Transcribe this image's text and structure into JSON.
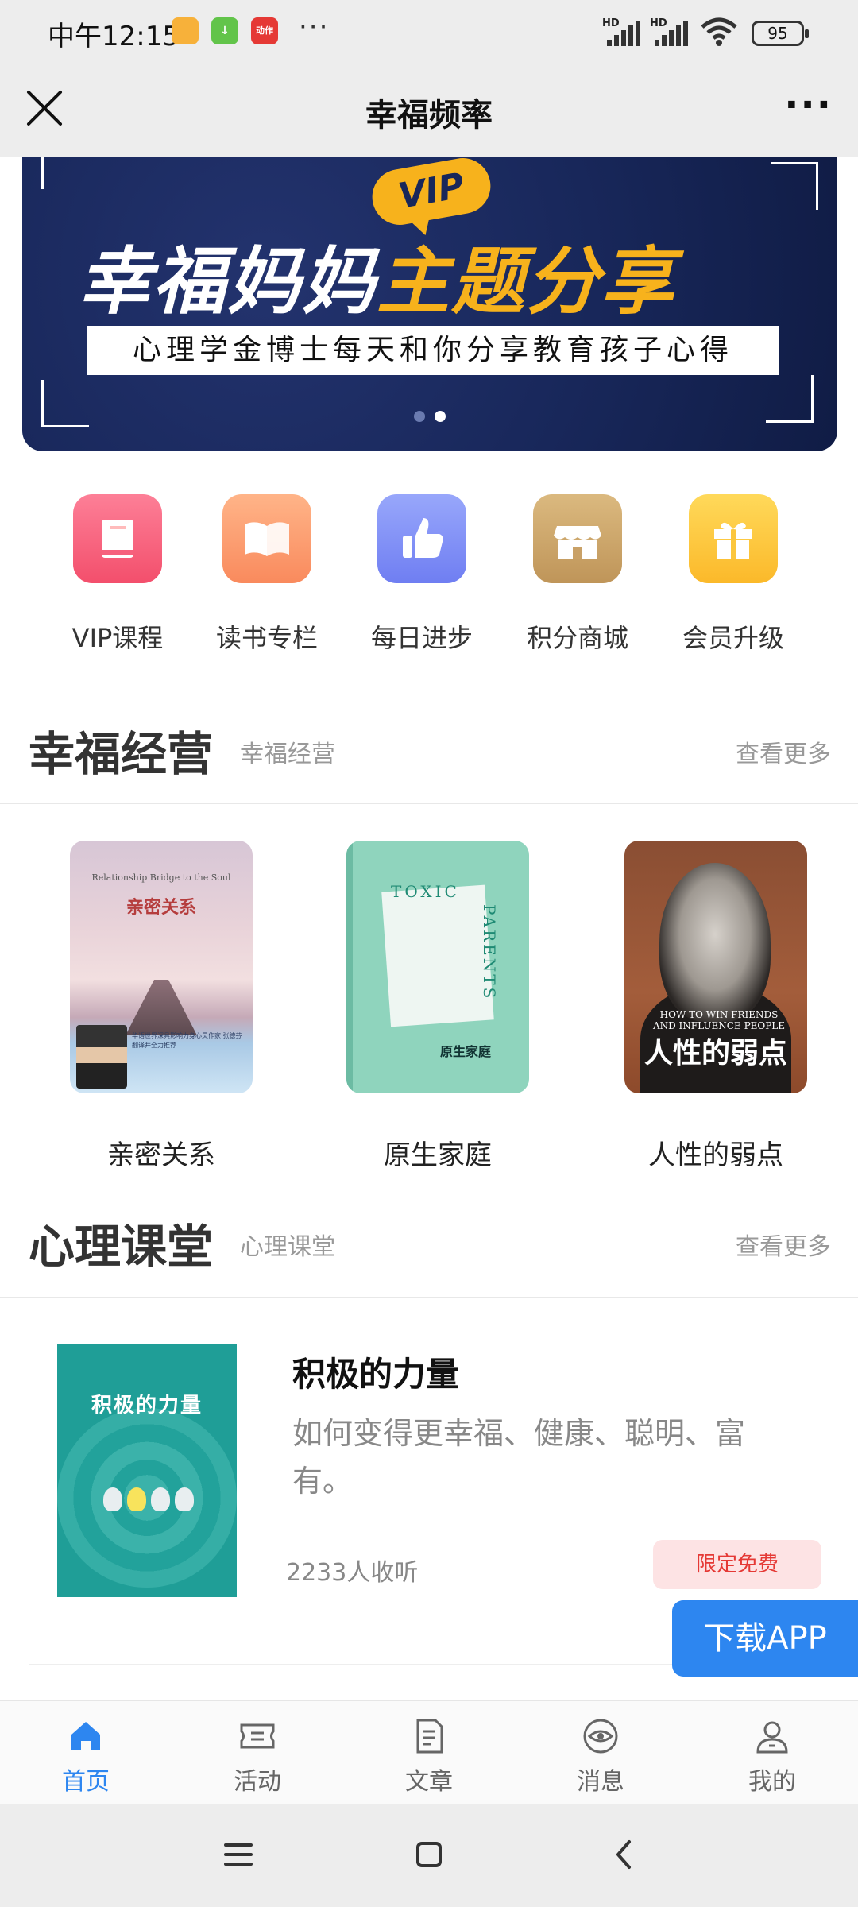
{
  "status_bar": {
    "time": "中午12:15",
    "apps": [
      "📙",
      "↓",
      "动作"
    ],
    "dots": "···",
    "signal1": "HD",
    "signal2": "HD",
    "battery": "95"
  },
  "nav": {
    "title": "幸福频率",
    "more": "···"
  },
  "banner": {
    "vip": "VIP",
    "title_white": "幸福妈妈",
    "title_yellow": "主题分享",
    "subtitle": "心理学金博士每天和你分享教育孩子心得",
    "slide_count": 2,
    "active_slide": 2
  },
  "quick_menu": [
    {
      "label": "VIP课程",
      "icon": "book-icon",
      "color": "#f6617d"
    },
    {
      "label": "读书专栏",
      "icon": "open-book-icon",
      "color": "#fb9a6c"
    },
    {
      "label": "每日进步",
      "icon": "thumbs-up-icon",
      "color": "#7f8ff7"
    },
    {
      "label": "积分商城",
      "icon": "shop-icon",
      "color": "#c9a167"
    },
    {
      "label": "会员升级",
      "icon": "gift-icon",
      "color": "#fbc63d"
    }
  ],
  "section_books": {
    "title": "幸福经营",
    "subtitle": "幸福经营",
    "more": "查看更多",
    "books": [
      {
        "title": "亲密关系",
        "cover_en": "Relationship Bridge to the Soul",
        "cover_zh": "亲密关系",
        "cover_blurb": "华语世界深具影响力身心灵作家 张德芬 翻译并全力推荐"
      },
      {
        "title": "原生家庭",
        "cover_en1": "TOXIC",
        "cover_en2": "PARENTS",
        "cover_zh": "原生家庭"
      },
      {
        "title": "人性的弱点",
        "cover_en": "HOW TO WIN FRIENDS AND INFLUENCE PEOPLE",
        "cover_zh": "人性的弱点"
      }
    ]
  },
  "section_courses": {
    "title": "心理课堂",
    "subtitle": "心理课堂",
    "more": "查看更多",
    "course": {
      "cover_title": "积极的力量",
      "title": "积极的力量",
      "description": "如何变得更幸福、健康、聪明、富有。",
      "listeners": "2233人收听",
      "badge": "限定免费"
    }
  },
  "download_button": "下载APP",
  "tabs": [
    {
      "label": "首页",
      "icon": "home-icon",
      "active": true
    },
    {
      "label": "活动",
      "icon": "ticket-icon",
      "active": false
    },
    {
      "label": "文章",
      "icon": "document-icon",
      "active": false
    },
    {
      "label": "消息",
      "icon": "eye-icon",
      "active": false
    },
    {
      "label": "我的",
      "icon": "user-icon",
      "active": false
    }
  ],
  "colors": {
    "accent": "#2d86f0",
    "badge_text": "#e53935",
    "banner_bg": "#18275a",
    "banner_yellow": "#f7b21c"
  }
}
